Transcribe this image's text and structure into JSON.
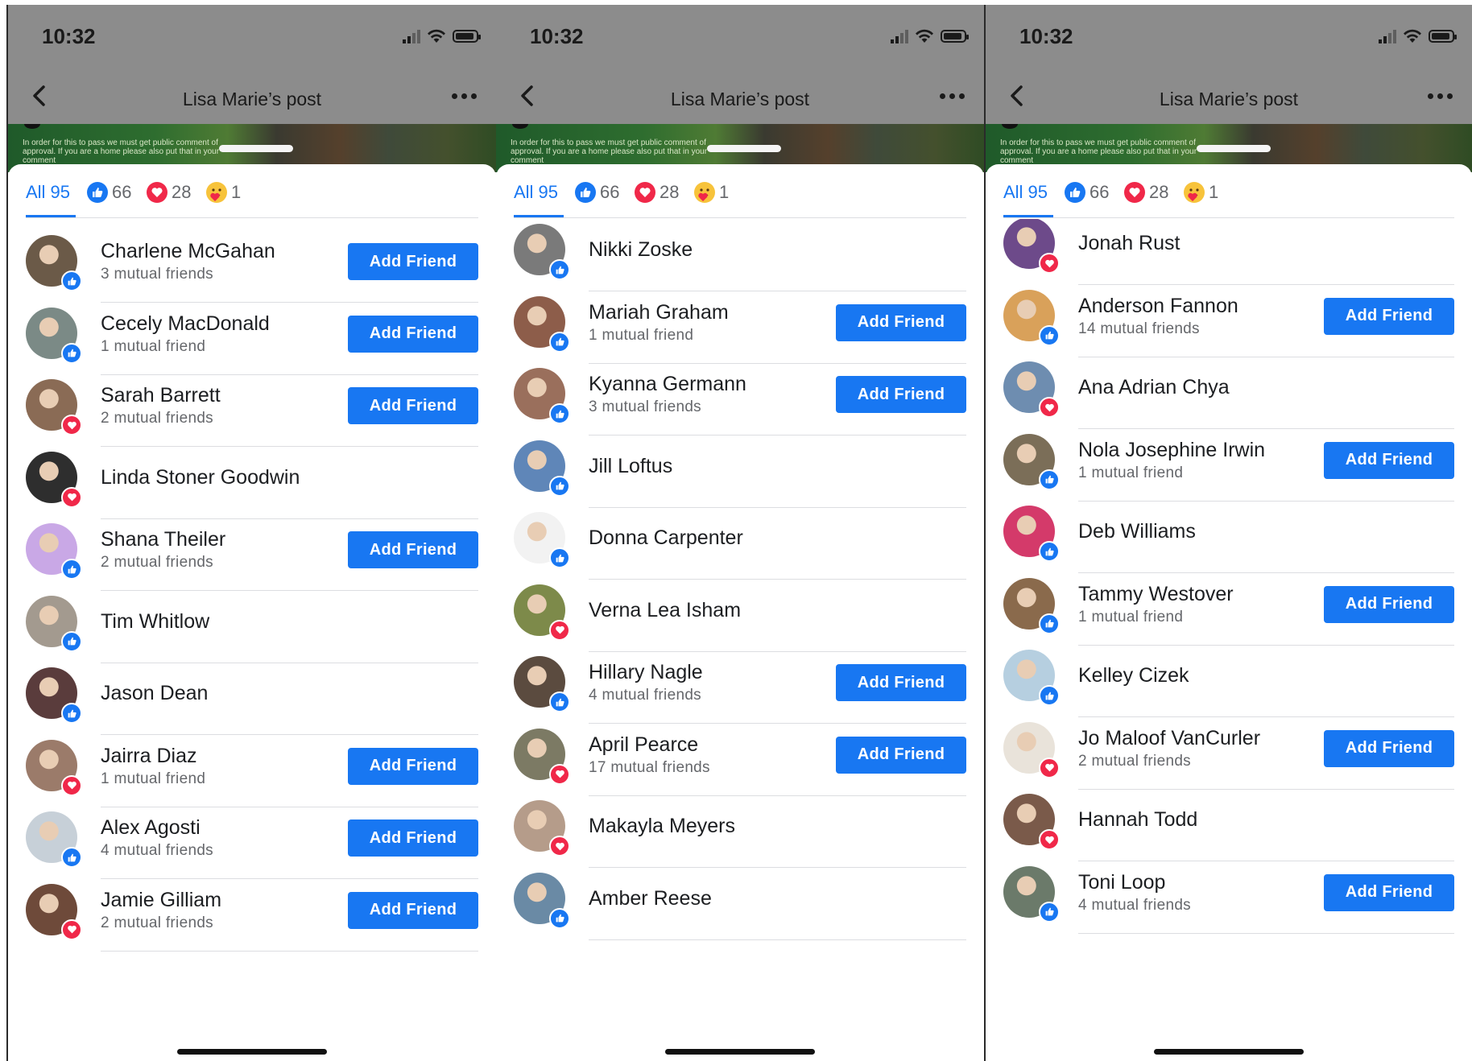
{
  "status_time": "10:32",
  "nav_title": "Lisa Marie’s post",
  "post_strip_text": "In order for this to pass we must get public comment of approval. If you are a home please also put that in your comment",
  "tabs": {
    "all": "All 95",
    "like_count": "66",
    "love_count": "28",
    "care_count": "1"
  },
  "add_friend_label": "Add Friend",
  "colors": {
    "accent": "#1877f2",
    "love": "#f02849",
    "header_overlay": "#8c8c8c"
  },
  "panels": [
    {
      "rows": [
        {
          "name": "Charlene McGahan",
          "mutual": "3 mutual friends",
          "reaction": "like",
          "add": true,
          "avatar": "#6b5a48"
        },
        {
          "name": "Cecely MacDonald",
          "mutual": "1 mutual friend",
          "reaction": "like",
          "add": true,
          "avatar": "#7b8a86"
        },
        {
          "name": "Sarah Barrett",
          "mutual": "2 mutual friends",
          "reaction": "love",
          "add": true,
          "avatar": "#8a6b55"
        },
        {
          "name": "Linda Stoner Goodwin",
          "mutual": "",
          "reaction": "love",
          "add": false,
          "avatar": "#2e2e2e"
        },
        {
          "name": "Shana Theiler",
          "mutual": "2 mutual friends",
          "reaction": "like",
          "add": true,
          "avatar": "#c9a8e6"
        },
        {
          "name": "Tim Whitlow",
          "mutual": "",
          "reaction": "like",
          "add": false,
          "avatar": "#a39a8f"
        },
        {
          "name": "Jason Dean",
          "mutual": "",
          "reaction": "like",
          "add": false,
          "avatar": "#5a3c3c"
        },
        {
          "name": "Jairra Diaz",
          "mutual": "1 mutual friend",
          "reaction": "love",
          "add": true,
          "avatar": "#9b7b6a"
        },
        {
          "name": "Alex Agosti",
          "mutual": "4 mutual friends",
          "reaction": "like",
          "add": true,
          "avatar": "#c7d0d8"
        },
        {
          "name": "Jamie Gilliam",
          "mutual": "2 mutual friends",
          "reaction": "love",
          "add": true,
          "avatar": "#6e4a3a"
        }
      ]
    },
    {
      "rows": [
        {
          "name": "Nikki Zoske",
          "mutual": "",
          "reaction": "like",
          "add": false,
          "avatar": "#7a7a7a"
        },
        {
          "name": "Mariah Graham",
          "mutual": "1 mutual friend",
          "reaction": "like",
          "add": true,
          "avatar": "#8d5d4a"
        },
        {
          "name": "Kyanna Germann",
          "mutual": "3 mutual friends",
          "reaction": "like",
          "add": true,
          "avatar": "#9a6f5c"
        },
        {
          "name": "Jill Loftus",
          "mutual": "",
          "reaction": "like",
          "add": false,
          "avatar": "#5f86b8"
        },
        {
          "name": "Donna Carpenter",
          "mutual": "",
          "reaction": "like",
          "add": false,
          "avatar": "#f2f2f2"
        },
        {
          "name": "Verna Lea Isham",
          "mutual": "",
          "reaction": "love",
          "add": false,
          "avatar": "#7d8a4a"
        },
        {
          "name": "Hillary Nagle",
          "mutual": "4 mutual friends",
          "reaction": "like",
          "add": true,
          "avatar": "#5b4b3f"
        },
        {
          "name": "April Pearce",
          "mutual": "17 mutual friends",
          "reaction": "love",
          "add": true,
          "avatar": "#7c7a64"
        },
        {
          "name": "Makayla Meyers",
          "mutual": "",
          "reaction": "love",
          "add": false,
          "avatar": "#b59c8a"
        },
        {
          "name": "Amber Reese",
          "mutual": "",
          "reaction": "like",
          "add": false,
          "avatar": "#6a8aa5"
        }
      ]
    },
    {
      "rows": [
        {
          "name": "Jonah Rust",
          "mutual": "",
          "reaction": "love",
          "add": false,
          "avatar": "#6d4a8a"
        },
        {
          "name": "Anderson Fannon",
          "mutual": "14 mutual friends",
          "reaction": "like",
          "add": true,
          "avatar": "#d9a15a"
        },
        {
          "name": "Ana Adrian Chya",
          "mutual": "",
          "reaction": "love",
          "add": false,
          "avatar": "#6e8db0"
        },
        {
          "name": "Nola Josephine Irwin",
          "mutual": "1 mutual friend",
          "reaction": "like",
          "add": true,
          "avatar": "#7b6e58"
        },
        {
          "name": "Deb Williams",
          "mutual": "",
          "reaction": "like",
          "add": false,
          "avatar": "#d43a6a"
        },
        {
          "name": "Tammy Westover",
          "mutual": "1 mutual friend",
          "reaction": "like",
          "add": true,
          "avatar": "#8a6a4c"
        },
        {
          "name": "Kelley Cizek",
          "mutual": "",
          "reaction": "like",
          "add": false,
          "avatar": "#b6cfe0"
        },
        {
          "name": "Jo Maloof VanCurler",
          "mutual": "2 mutual friends",
          "reaction": "love",
          "add": true,
          "avatar": "#e9e3da"
        },
        {
          "name": "Hannah Todd",
          "mutual": "",
          "reaction": "love",
          "add": false,
          "avatar": "#7a5a4a"
        },
        {
          "name": "Toni Loop",
          "mutual": "4 mutual friends",
          "reaction": "like",
          "add": true,
          "avatar": "#6b7a6a"
        }
      ]
    }
  ]
}
